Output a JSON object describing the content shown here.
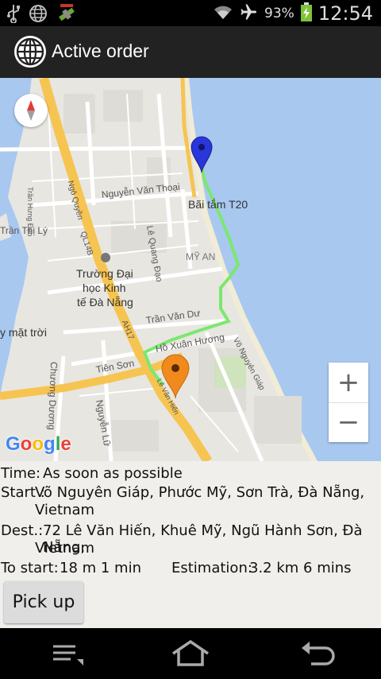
{
  "status_bar": {
    "battery_percent": "93%",
    "time": "12:54",
    "icons": [
      "usb-icon",
      "globe-icon",
      "satellite-icon",
      "wifi-icon",
      "airplane-mode-icon",
      "battery-charging-icon"
    ]
  },
  "action_bar": {
    "title": "Active order",
    "icon": "globe-icon"
  },
  "map": {
    "labels": {
      "beach": "Bãi tắm T20",
      "nguyen_van_thoai": "Nguyễn Văn Thoại",
      "le_quang_dao": "Lê Quang Đạo",
      "my_an": "MỸ AN",
      "university_line1": "Trường Đại",
      "university_line2": "học Kinh",
      "university_line3": "tế Đà Nẵng",
      "tran_van_du": "Trần Văn Dư",
      "ho_xuan_huong": "Hồ Xuân Hương",
      "vo_nguyen_giap": "Võ Nguyên Giáp",
      "tien_son": "Tiên Sơn",
      "chuong_duong": "Chương Dương",
      "nguyen_lu": "Nguyễn Lữ",
      "tran_thi_ly": "Trần Thị Lý",
      "tran_hung_dao": "Trần Hưng Đạo",
      "ngo_quyen": "Ngô Quyền",
      "ql14b": "QL14B",
      "ah17": "AH17",
      "le_van_hien": "Lê Văn Hiến",
      "mat_troi": "y mặt trời"
    },
    "zoom_in": "+",
    "zoom_out": "−",
    "logo": "Google",
    "route_color": "#7be86d",
    "start_marker_color": "#2a36d9",
    "dest_marker_color": "#f08a1c"
  },
  "order": {
    "time_label": "Time:",
    "time_value": "As soon as possible",
    "start_label": "Start :",
    "start_line1": "Võ Nguyên Giáp, Phước Mỹ, Sơn Trà, Đà Nẵng,",
    "start_line2": "Vietnam",
    "dest_label": "Dest.:",
    "dest_line1": "72 Lê Văn Hiến, Khuê Mỹ, Ngũ Hành Sơn, Đà Nẵng,",
    "dest_line2": "Vietnam",
    "to_start_label": "To start:",
    "to_start_value": "18 m 1 min",
    "estimation_label": "Estimation:",
    "estimation_value": "3.2 km 6 mins"
  },
  "pickup_button": "Pick up",
  "nav_bar": {
    "icons": [
      "menu-icon",
      "home-icon",
      "back-icon"
    ]
  }
}
